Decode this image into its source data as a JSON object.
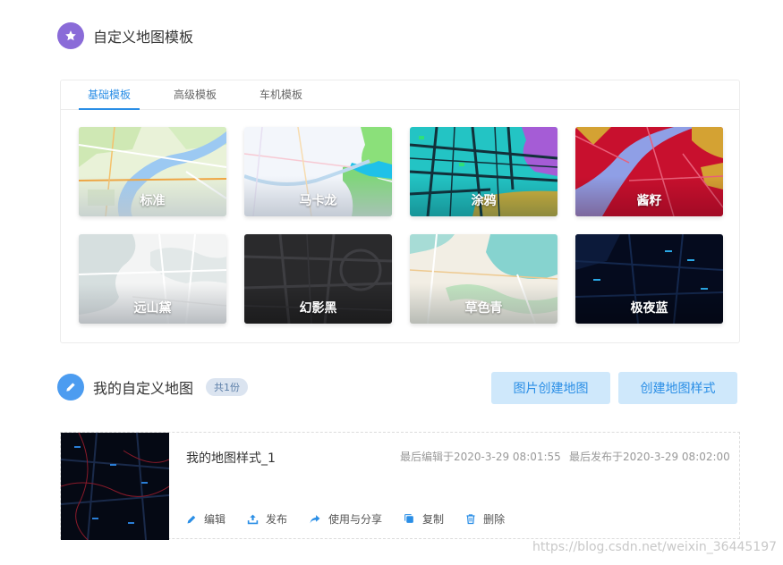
{
  "templates_section": {
    "title": "自定义地图模板",
    "icon": "star-icon"
  },
  "tabs": [
    {
      "label": "基础模板",
      "active": true
    },
    {
      "label": "高级模板",
      "active": false
    },
    {
      "label": "车机模板",
      "active": false
    }
  ],
  "templates": [
    {
      "label": "标准"
    },
    {
      "label": "马卡龙"
    },
    {
      "label": "涂鸦"
    },
    {
      "label": "酱籽"
    },
    {
      "label": "远山黛"
    },
    {
      "label": "幻影黑"
    },
    {
      "label": "草色青"
    },
    {
      "label": "极夜蓝"
    }
  ],
  "my_maps_section": {
    "title": "我的自定义地图",
    "count_badge": "共1份",
    "icon": "pencil-icon"
  },
  "buttons": {
    "image_create": "图片创建地图",
    "style_create": "创建地图样式"
  },
  "map_item": {
    "name": "我的地图样式_1",
    "last_edited": "最后编辑于2020-3-29 08:01:55",
    "last_published": "最后发布于2020-3-29 08:02:00",
    "actions": {
      "edit": "编辑",
      "publish": "发布",
      "use_share": "使用与分享",
      "copy": "复制",
      "delete": "删除"
    }
  },
  "watermark": "https://blog.csdn.net/weixin_36445197",
  "colors": {
    "accent": "#2a8ee6",
    "button_bg": "#cfe8fb",
    "star_circle": "#8a6bd8",
    "pencil_circle": "#4c9cf0"
  }
}
